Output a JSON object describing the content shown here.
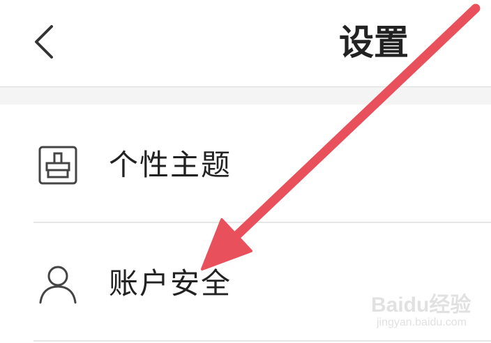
{
  "header": {
    "title": "设置",
    "back_icon": "chevron-left-icon"
  },
  "menu": {
    "items": [
      {
        "label": "个性主题",
        "icon": "theme-brush-icon"
      },
      {
        "label": "账户安全",
        "icon": "user-icon"
      }
    ]
  },
  "annotation": {
    "arrow_color": "#e8505b"
  },
  "watermark": {
    "brand": "Baidu经验",
    "url": "jingyan.baidu.com"
  }
}
